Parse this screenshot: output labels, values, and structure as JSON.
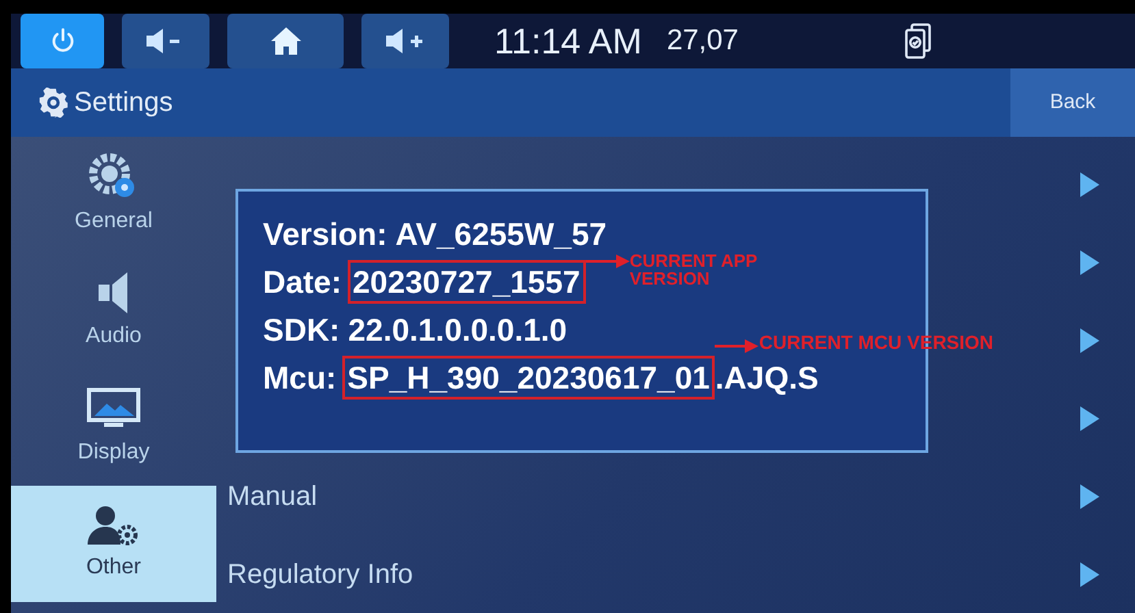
{
  "top_bar": {
    "buttons": [
      {
        "kind": "power",
        "selected": true
      },
      {
        "kind": "volume_down",
        "selected": false
      },
      {
        "kind": "home",
        "selected": false
      },
      {
        "kind": "volume_up",
        "selected": false
      }
    ],
    "time": "11:14 AM",
    "date": "27,07"
  },
  "header": {
    "title": "Settings",
    "back": "Back"
  },
  "sidebar": {
    "items": [
      {
        "kind": "general",
        "label": "General",
        "selected": false
      },
      {
        "kind": "audio",
        "label": "Audio",
        "selected": false
      },
      {
        "kind": "display",
        "label": "Display",
        "selected": false
      },
      {
        "kind": "other",
        "label": "Other",
        "selected": true
      }
    ]
  },
  "list": {
    "rows": [
      {
        "kind": "covered"
      },
      {
        "kind": "covered"
      },
      {
        "kind": "covered"
      },
      {
        "kind": "covered"
      },
      {
        "kind": "item",
        "label": "Manual"
      },
      {
        "kind": "item",
        "label": "Regulatory Info"
      }
    ]
  },
  "popup": {
    "lines": [
      {
        "label": "Version:",
        "value": "AV_6255W_57"
      },
      {
        "label": "Date:",
        "highlight": "20230727_1557",
        "note": "CURRENT APP VERSION"
      },
      {
        "label": "SDK:",
        "value": "22.0.1.0.0.0.1.0"
      },
      {
        "label": "Mcu:",
        "highlight": "SP_H_390_20230617_01",
        "rest": ".AJQ.S",
        "note": "CURRENT MCU VERSION"
      }
    ]
  }
}
